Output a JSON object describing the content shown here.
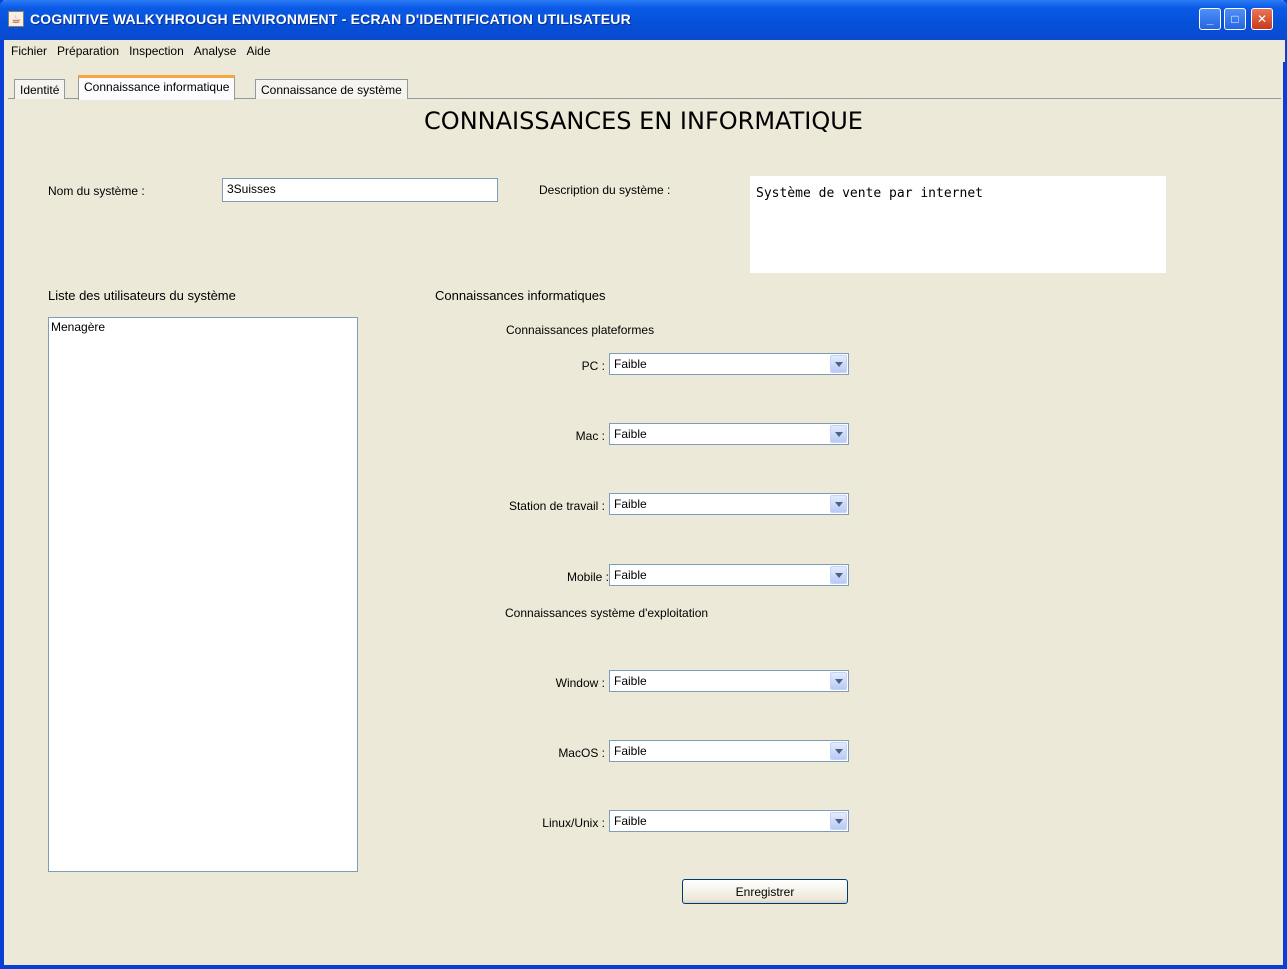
{
  "window": {
    "title": "COGNITIVE WALKYHROUGH ENVIRONMENT - ECRAN D'IDENTIFICATION UTILISATEUR",
    "minimize_glyph": "_",
    "maximize_glyph": "□",
    "close_glyph": "✕"
  },
  "menubar": {
    "items": [
      "Fichier",
      "Préparation",
      "Inspection",
      "Analyse",
      "Aide"
    ]
  },
  "tabs": [
    {
      "label": "Identité",
      "active": false
    },
    {
      "label": "Connaissance informatique",
      "active": true
    },
    {
      "label": "Connaissance de système",
      "active": false
    }
  ],
  "page": {
    "heading": "CONNAISSANCES EN INFORMATIQUE",
    "system_name_label": "Nom du système :",
    "system_name_value": "3Suisses",
    "system_description_label": "Description du système :",
    "system_description_value": "Système de vente par internet",
    "users_list_label": "Liste des utilisateurs du système",
    "users": [
      "Menagère"
    ],
    "knowledge_label": "Connaissances informatiques",
    "platforms_label": "Connaissances plateformes",
    "platforms": [
      {
        "label": "PC :",
        "value": "Faible"
      },
      {
        "label": "Mac :",
        "value": "Faible"
      },
      {
        "label": "Station de travail :",
        "value": "Faible"
      },
      {
        "label": "Mobile :",
        "value": "Faible"
      }
    ],
    "os_label": "Connaissances système d'exploitation",
    "os": [
      {
        "label": "Window :",
        "value": "Faible"
      },
      {
        "label": "MacOS :",
        "value": "Faible"
      },
      {
        "label": "Linux/Unix :",
        "value": "Faible"
      }
    ],
    "save_button": "Enregistrer"
  },
  "colors": {
    "titlebar": "#0550d8",
    "window_background": "#ece9d8",
    "active_tab_accent": "#f7a73f",
    "field_border": "#7f9db9"
  },
  "icons": [
    "java-app-icon",
    "minimize-icon",
    "maximize-icon",
    "close-icon",
    "chevron-down-icon"
  ]
}
